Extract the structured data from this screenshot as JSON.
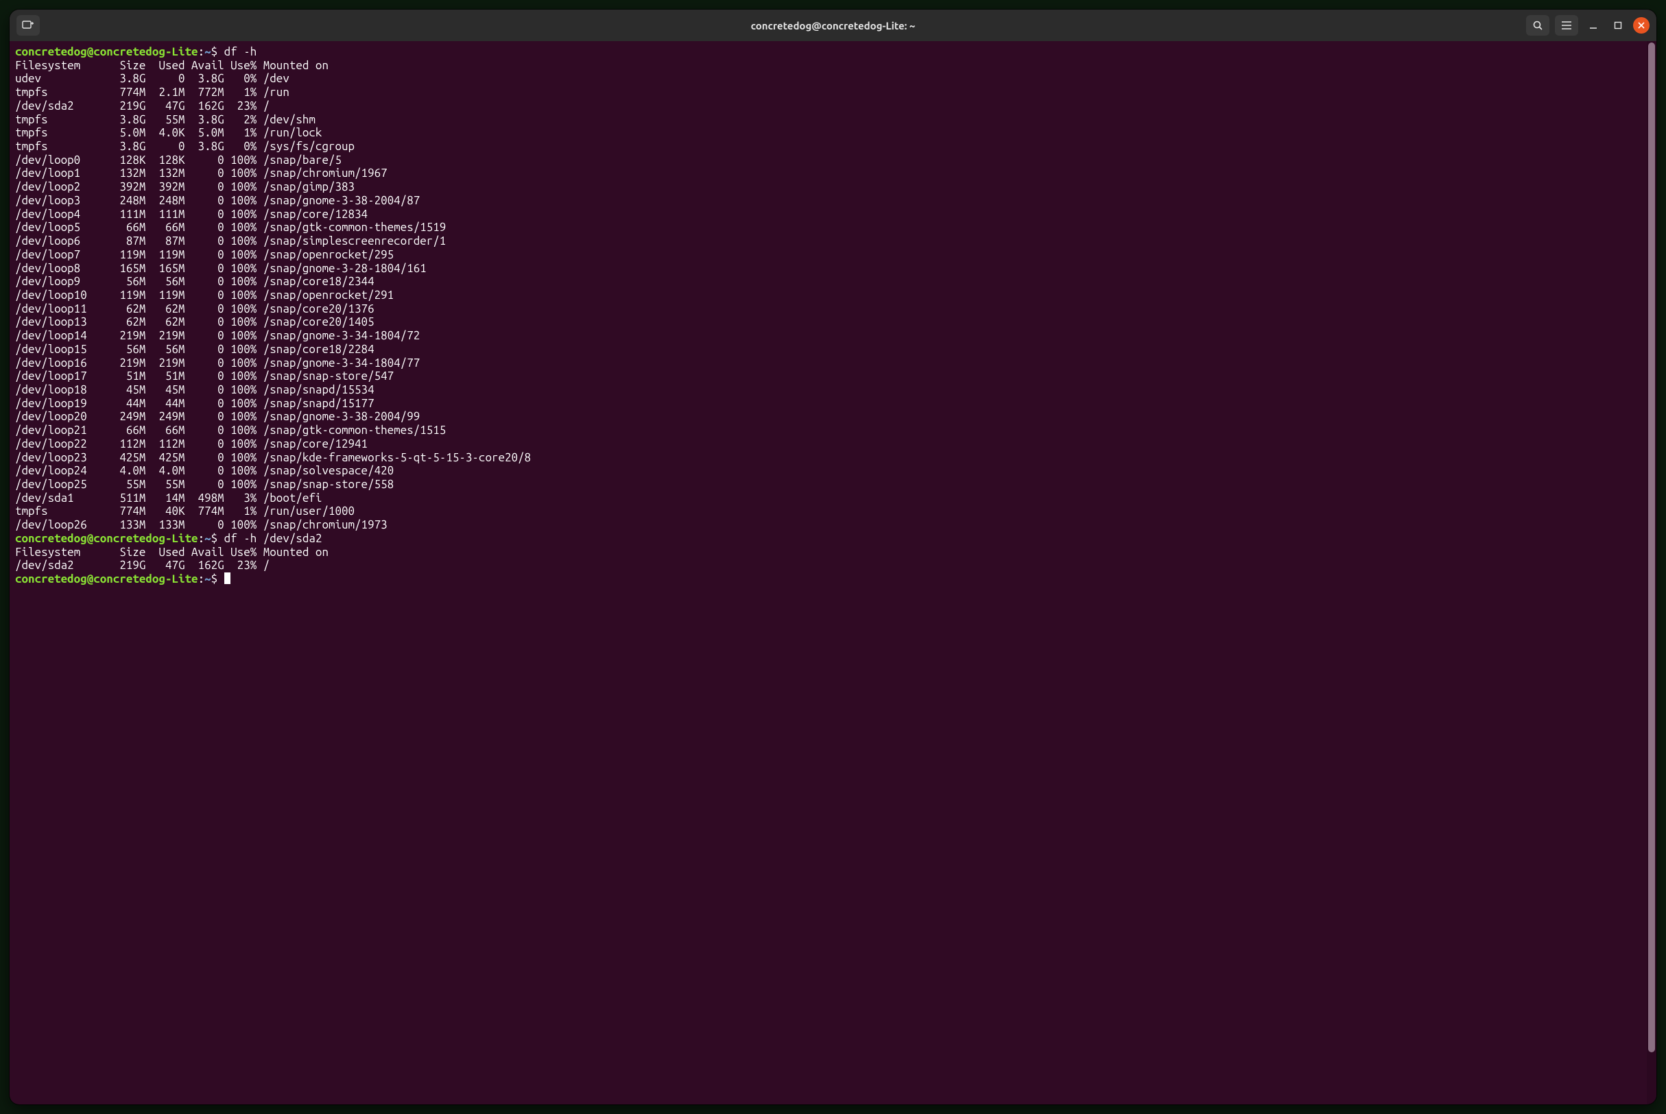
{
  "window": {
    "title": "concretedog@concretedog-Lite: ~"
  },
  "prompt": {
    "userhost": "concretedog@concretedog-Lite",
    "sep1": ":",
    "path": "~",
    "sep2": "$ "
  },
  "commands": {
    "c1": "df -h",
    "c2": "df -h /dev/sda2",
    "c3": ""
  },
  "header": "Filesystem      Size  Used Avail Use% Mounted on",
  "rows1": [
    {
      "fs": "udev",
      "size": "3.8G",
      "used": "0",
      "avail": "3.8G",
      "usep": "0%",
      "mount": "/dev"
    },
    {
      "fs": "tmpfs",
      "size": "774M",
      "used": "2.1M",
      "avail": "772M",
      "usep": "1%",
      "mount": "/run"
    },
    {
      "fs": "/dev/sda2",
      "size": "219G",
      "used": "47G",
      "avail": "162G",
      "usep": "23%",
      "mount": "/"
    },
    {
      "fs": "tmpfs",
      "size": "3.8G",
      "used": "55M",
      "avail": "3.8G",
      "usep": "2%",
      "mount": "/dev/shm"
    },
    {
      "fs": "tmpfs",
      "size": "5.0M",
      "used": "4.0K",
      "avail": "5.0M",
      "usep": "1%",
      "mount": "/run/lock"
    },
    {
      "fs": "tmpfs",
      "size": "3.8G",
      "used": "0",
      "avail": "3.8G",
      "usep": "0%",
      "mount": "/sys/fs/cgroup"
    },
    {
      "fs": "/dev/loop0",
      "size": "128K",
      "used": "128K",
      "avail": "0",
      "usep": "100%",
      "mount": "/snap/bare/5"
    },
    {
      "fs": "/dev/loop1",
      "size": "132M",
      "used": "132M",
      "avail": "0",
      "usep": "100%",
      "mount": "/snap/chromium/1967"
    },
    {
      "fs": "/dev/loop2",
      "size": "392M",
      "used": "392M",
      "avail": "0",
      "usep": "100%",
      "mount": "/snap/gimp/383"
    },
    {
      "fs": "/dev/loop3",
      "size": "248M",
      "used": "248M",
      "avail": "0",
      "usep": "100%",
      "mount": "/snap/gnome-3-38-2004/87"
    },
    {
      "fs": "/dev/loop4",
      "size": "111M",
      "used": "111M",
      "avail": "0",
      "usep": "100%",
      "mount": "/snap/core/12834"
    },
    {
      "fs": "/dev/loop5",
      "size": "66M",
      "used": "66M",
      "avail": "0",
      "usep": "100%",
      "mount": "/snap/gtk-common-themes/1519"
    },
    {
      "fs": "/dev/loop6",
      "size": "87M",
      "used": "87M",
      "avail": "0",
      "usep": "100%",
      "mount": "/snap/simplescreenrecorder/1"
    },
    {
      "fs": "/dev/loop7",
      "size": "119M",
      "used": "119M",
      "avail": "0",
      "usep": "100%",
      "mount": "/snap/openrocket/295"
    },
    {
      "fs": "/dev/loop8",
      "size": "165M",
      "used": "165M",
      "avail": "0",
      "usep": "100%",
      "mount": "/snap/gnome-3-28-1804/161"
    },
    {
      "fs": "/dev/loop9",
      "size": "56M",
      "used": "56M",
      "avail": "0",
      "usep": "100%",
      "mount": "/snap/core18/2344"
    },
    {
      "fs": "/dev/loop10",
      "size": "119M",
      "used": "119M",
      "avail": "0",
      "usep": "100%",
      "mount": "/snap/openrocket/291"
    },
    {
      "fs": "/dev/loop11",
      "size": "62M",
      "used": "62M",
      "avail": "0",
      "usep": "100%",
      "mount": "/snap/core20/1376"
    },
    {
      "fs": "/dev/loop13",
      "size": "62M",
      "used": "62M",
      "avail": "0",
      "usep": "100%",
      "mount": "/snap/core20/1405"
    },
    {
      "fs": "/dev/loop14",
      "size": "219M",
      "used": "219M",
      "avail": "0",
      "usep": "100%",
      "mount": "/snap/gnome-3-34-1804/72"
    },
    {
      "fs": "/dev/loop15",
      "size": "56M",
      "used": "56M",
      "avail": "0",
      "usep": "100%",
      "mount": "/snap/core18/2284"
    },
    {
      "fs": "/dev/loop16",
      "size": "219M",
      "used": "219M",
      "avail": "0",
      "usep": "100%",
      "mount": "/snap/gnome-3-34-1804/77"
    },
    {
      "fs": "/dev/loop17",
      "size": "51M",
      "used": "51M",
      "avail": "0",
      "usep": "100%",
      "mount": "/snap/snap-store/547"
    },
    {
      "fs": "/dev/loop18",
      "size": "45M",
      "used": "45M",
      "avail": "0",
      "usep": "100%",
      "mount": "/snap/snapd/15534"
    },
    {
      "fs": "/dev/loop19",
      "size": "44M",
      "used": "44M",
      "avail": "0",
      "usep": "100%",
      "mount": "/snap/snapd/15177"
    },
    {
      "fs": "/dev/loop20",
      "size": "249M",
      "used": "249M",
      "avail": "0",
      "usep": "100%",
      "mount": "/snap/gnome-3-38-2004/99"
    },
    {
      "fs": "/dev/loop21",
      "size": "66M",
      "used": "66M",
      "avail": "0",
      "usep": "100%",
      "mount": "/snap/gtk-common-themes/1515"
    },
    {
      "fs": "/dev/loop22",
      "size": "112M",
      "used": "112M",
      "avail": "0",
      "usep": "100%",
      "mount": "/snap/core/12941"
    },
    {
      "fs": "/dev/loop23",
      "size": "425M",
      "used": "425M",
      "avail": "0",
      "usep": "100%",
      "mount": "/snap/kde-frameworks-5-qt-5-15-3-core20/8"
    },
    {
      "fs": "/dev/loop24",
      "size": "4.0M",
      "used": "4.0M",
      "avail": "0",
      "usep": "100%",
      "mount": "/snap/solvespace/420"
    },
    {
      "fs": "/dev/loop25",
      "size": "55M",
      "used": "55M",
      "avail": "0",
      "usep": "100%",
      "mount": "/snap/snap-store/558"
    },
    {
      "fs": "/dev/sda1",
      "size": "511M",
      "used": "14M",
      "avail": "498M",
      "usep": "3%",
      "mount": "/boot/efi"
    },
    {
      "fs": "tmpfs",
      "size": "774M",
      "used": "40K",
      "avail": "774M",
      "usep": "1%",
      "mount": "/run/user/1000"
    },
    {
      "fs": "/dev/loop26",
      "size": "133M",
      "used": "133M",
      "avail": "0",
      "usep": "100%",
      "mount": "/snap/chromium/1973"
    }
  ],
  "rows2": [
    {
      "fs": "/dev/sda2",
      "size": "219G",
      "used": "47G",
      "avail": "162G",
      "usep": "23%",
      "mount": "/"
    }
  ]
}
